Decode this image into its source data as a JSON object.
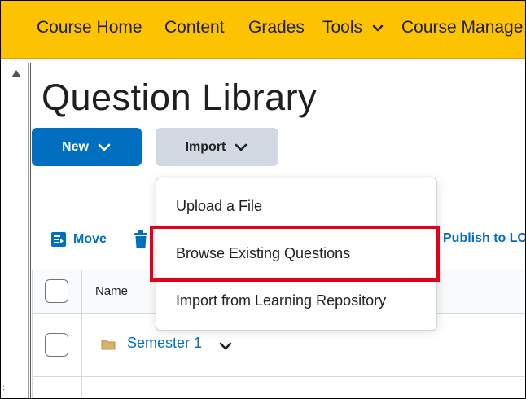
{
  "navbar": {
    "items": [
      "Course Home",
      "Content",
      "Grades",
      "Tools",
      "Course Manage"
    ],
    "tools_has_dropdown": true,
    "background": "#fec300"
  },
  "page": {
    "title": "Question Library"
  },
  "buttons": {
    "new_label": "New",
    "import_label": "Import",
    "new_color": "#006fbf"
  },
  "toolbar": {
    "move_label": "Move",
    "publish_label": "Publish to LO"
  },
  "table": {
    "header_name": "Name",
    "rows": [
      {
        "label": "Semester 1",
        "type": "folder"
      }
    ]
  },
  "import_menu": {
    "items": [
      "Upload a File",
      "Browse Existing Questions",
      "Import from Learning Repository"
    ],
    "highlighted_index": 1,
    "highlight_color": "#e4001b"
  }
}
